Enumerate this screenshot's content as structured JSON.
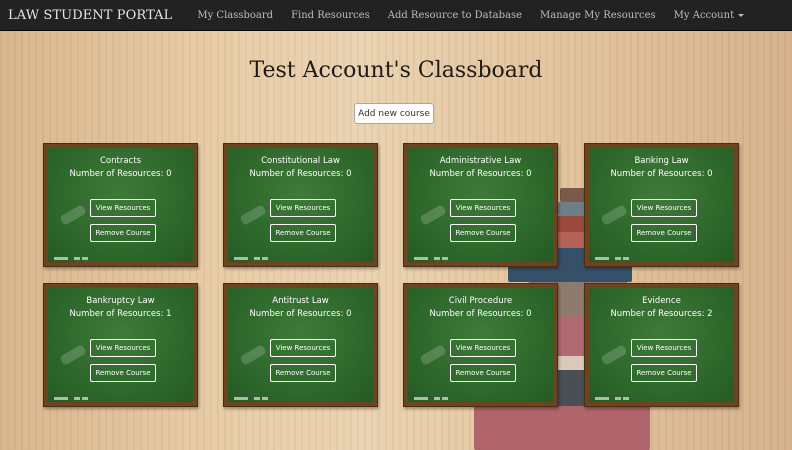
{
  "navbar": {
    "brand": "LAW STUDENT PORTAL",
    "items": [
      {
        "label": "My Classboard"
      },
      {
        "label": "Find Resources"
      },
      {
        "label": "Add Resource to Database"
      },
      {
        "label": "Manage My Resources"
      },
      {
        "label": "My Account",
        "has_caret": true
      }
    ]
  },
  "page": {
    "title": "Test Account's Classboard",
    "add_course_label": "Add new course"
  },
  "courses": [
    {
      "name": "Contracts",
      "count_label": "Number of Resources: 0",
      "view_label": "View Resources",
      "remove_label": "Remove Course"
    },
    {
      "name": "Constitutional Law",
      "count_label": "Number of Resources: 0",
      "view_label": "View Resources",
      "remove_label": "Remove Course"
    },
    {
      "name": "Administrative Law",
      "count_label": "Number of Resources: 0",
      "view_label": "View Resources",
      "remove_label": "Remove Course"
    },
    {
      "name": "Banking Law",
      "count_label": "Number of Resources: 0",
      "view_label": "View Resources",
      "remove_label": "Remove Course"
    },
    {
      "name": "Bankruptcy Law",
      "count_label": "Number of Resources: 1",
      "view_label": "View Resources",
      "remove_label": "Remove Course"
    },
    {
      "name": "Antitrust Law",
      "count_label": "Number of Resources: 0",
      "view_label": "View Resources",
      "remove_label": "Remove Course"
    },
    {
      "name": "Civil Procedure",
      "count_label": "Number of Resources: 0",
      "view_label": "View Resources",
      "remove_label": "Remove Course"
    },
    {
      "name": "Evidence",
      "count_label": "Number of Resources: 2",
      "view_label": "View Resources",
      "remove_label": "Remove Course"
    }
  ],
  "colors": {
    "navbar_bg": "#222222",
    "board_green": "#2f6a2c",
    "board_frame": "#6b4420"
  }
}
